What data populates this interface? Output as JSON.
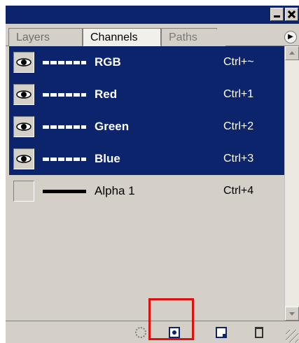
{
  "tabs": [
    {
      "label": "Layers",
      "active": false
    },
    {
      "label": "Channels",
      "active": true
    },
    {
      "label": "Paths",
      "active": false
    }
  ],
  "channels": [
    {
      "name": "RGB",
      "shortcut": "Ctrl+~",
      "visible": true,
      "selected": true
    },
    {
      "name": "Red",
      "shortcut": "Ctrl+1",
      "visible": true,
      "selected": true
    },
    {
      "name": "Green",
      "shortcut": "Ctrl+2",
      "visible": true,
      "selected": true
    },
    {
      "name": "Blue",
      "shortcut": "Ctrl+3",
      "visible": true,
      "selected": true
    },
    {
      "name": "Alpha 1",
      "shortcut": "Ctrl+4",
      "visible": false,
      "selected": false
    }
  ],
  "bottom_icons": [
    "load-selection-icon",
    "save-selection-icon",
    "new-channel-icon",
    "delete-channel-icon"
  ],
  "colors": {
    "selection": "#0b246b",
    "panel": "#d4d0c8",
    "highlight": "#e01010"
  }
}
